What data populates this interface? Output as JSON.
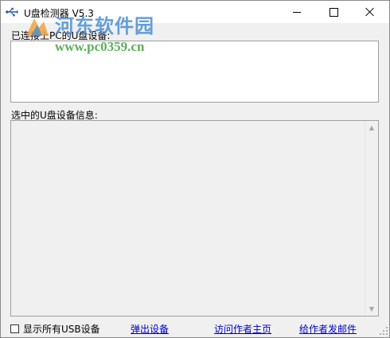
{
  "window": {
    "title": "U盘检测器 V5.3"
  },
  "icons": {
    "app": "usb-icon",
    "minimize": "minimize-icon",
    "maximize": "maximize-icon",
    "close": "close-icon"
  },
  "main": {
    "connected_label": "已连接上PC的U盘设备:",
    "selected_info_label": "选中的U盘设备信息:"
  },
  "watermark": {
    "title": "河东软件园",
    "url": "www.pc0359.cn"
  },
  "bottom": {
    "show_all_label": "显示所有USB设备",
    "show_all_checked": false,
    "eject_link": "弹出设备",
    "homepage_link": "访问作者主页",
    "email_link": "给作者发邮件"
  },
  "colors": {
    "link": "#0000cc",
    "watermark_blue": "#4a8fd6",
    "watermark_green": "#4aa84a",
    "window_bg": "#f0f0f0"
  }
}
